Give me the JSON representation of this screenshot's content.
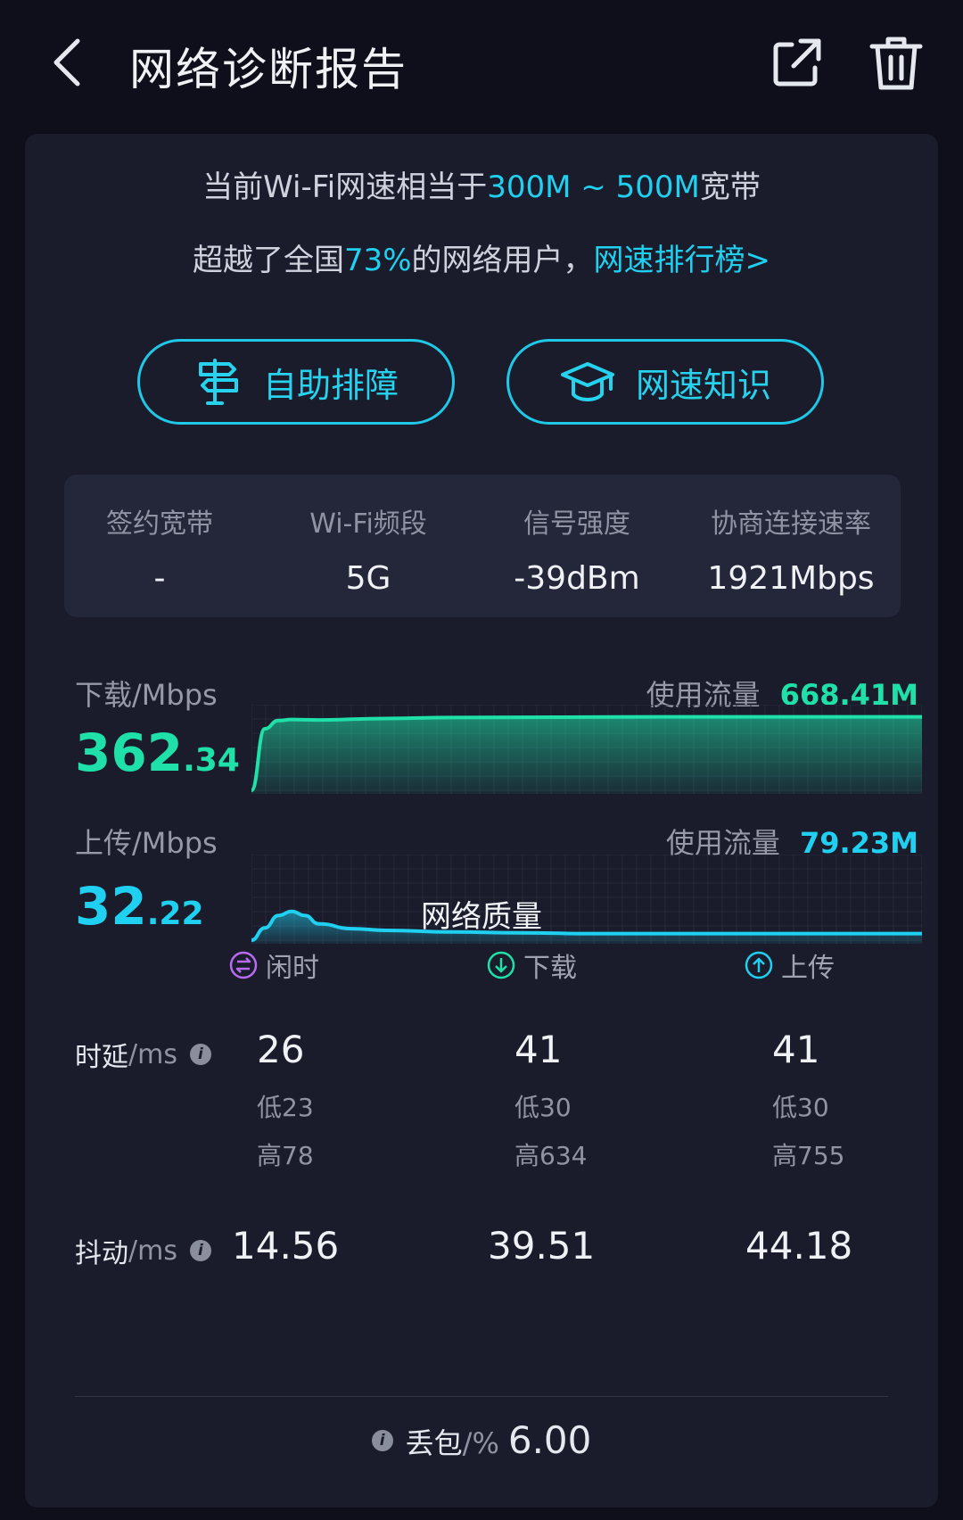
{
  "header": {
    "title": "网络诊断报告",
    "back_icon": "chevron-left-icon",
    "share_icon": "share-icon",
    "delete_icon": "trash-icon"
  },
  "summary": {
    "line1_prefix": "当前Wi-Fi网速相当于",
    "line1_highlight": "300M ~ 500M",
    "line1_suffix": "宽带",
    "line2_prefix": "超越了全国",
    "line2_highlight": "73%",
    "line2_suffix": "的网络用户，",
    "rank_link": "网速排行榜>"
  },
  "actions": {
    "self_help": "自助排障",
    "knowledge": "网速知识"
  },
  "stats": [
    {
      "label": "签约宽带",
      "value": "-"
    },
    {
      "label": "Wi-Fi频段",
      "value": "5G"
    },
    {
      "label": "信号强度",
      "value": "-39dBm"
    },
    {
      "label": "协商连接速率",
      "value": "1921Mbps"
    }
  ],
  "download": {
    "label": "下载/Mbps",
    "speed_int": "362",
    "speed_dec": ".34",
    "usage_label": "使用流量",
    "usage_value": "668.41M",
    "color": "#1ee0a8"
  },
  "upload": {
    "label": "上传/Mbps",
    "speed_int": "32",
    "speed_dec": ".22",
    "usage_label": "使用流量",
    "usage_value": "79.23M",
    "color": "#1fd0f0"
  },
  "chart_data": [
    {
      "type": "area",
      "x": [
        0,
        2,
        4,
        6,
        10,
        20,
        30,
        40,
        50,
        60,
        70,
        80,
        90,
        100
      ],
      "values": [
        0,
        300,
        340,
        345,
        343,
        350,
        355,
        356,
        357,
        358,
        358,
        358,
        358,
        358
      ],
      "ylim": [
        0,
        400
      ]
    },
    {
      "type": "area",
      "x": [
        0,
        2,
        4,
        6,
        8,
        10,
        15,
        20,
        30,
        40,
        50,
        60,
        70,
        80,
        90,
        100
      ],
      "values": [
        0,
        15,
        30,
        35,
        30,
        20,
        14,
        12,
        10,
        9,
        8,
        8,
        8,
        8,
        8,
        8
      ],
      "ylim": [
        0,
        100
      ]
    }
  ],
  "quality": {
    "title": "网络质量",
    "columns": [
      {
        "label": "闲时",
        "icon": "swap-icon",
        "color": "#b86bf2"
      },
      {
        "label": "下载",
        "icon": "arrow-down-circle-icon",
        "color": "#1ee0a8"
      },
      {
        "label": "上传",
        "icon": "arrow-up-circle-icon",
        "color": "#1fd0f0"
      }
    ],
    "latency": {
      "label": "时延",
      "unit": "/ms",
      "values": [
        "26",
        "41",
        "41"
      ],
      "lows": [
        "低23",
        "低30",
        "低30"
      ],
      "highs": [
        "高78",
        "高634",
        "高755"
      ]
    },
    "jitter": {
      "label": "抖动",
      "unit": "/ms",
      "values": [
        "14.56",
        "39.51",
        "44.18"
      ]
    },
    "loss": {
      "label": "丢包",
      "unit": "/%",
      "value": "6.00"
    }
  }
}
